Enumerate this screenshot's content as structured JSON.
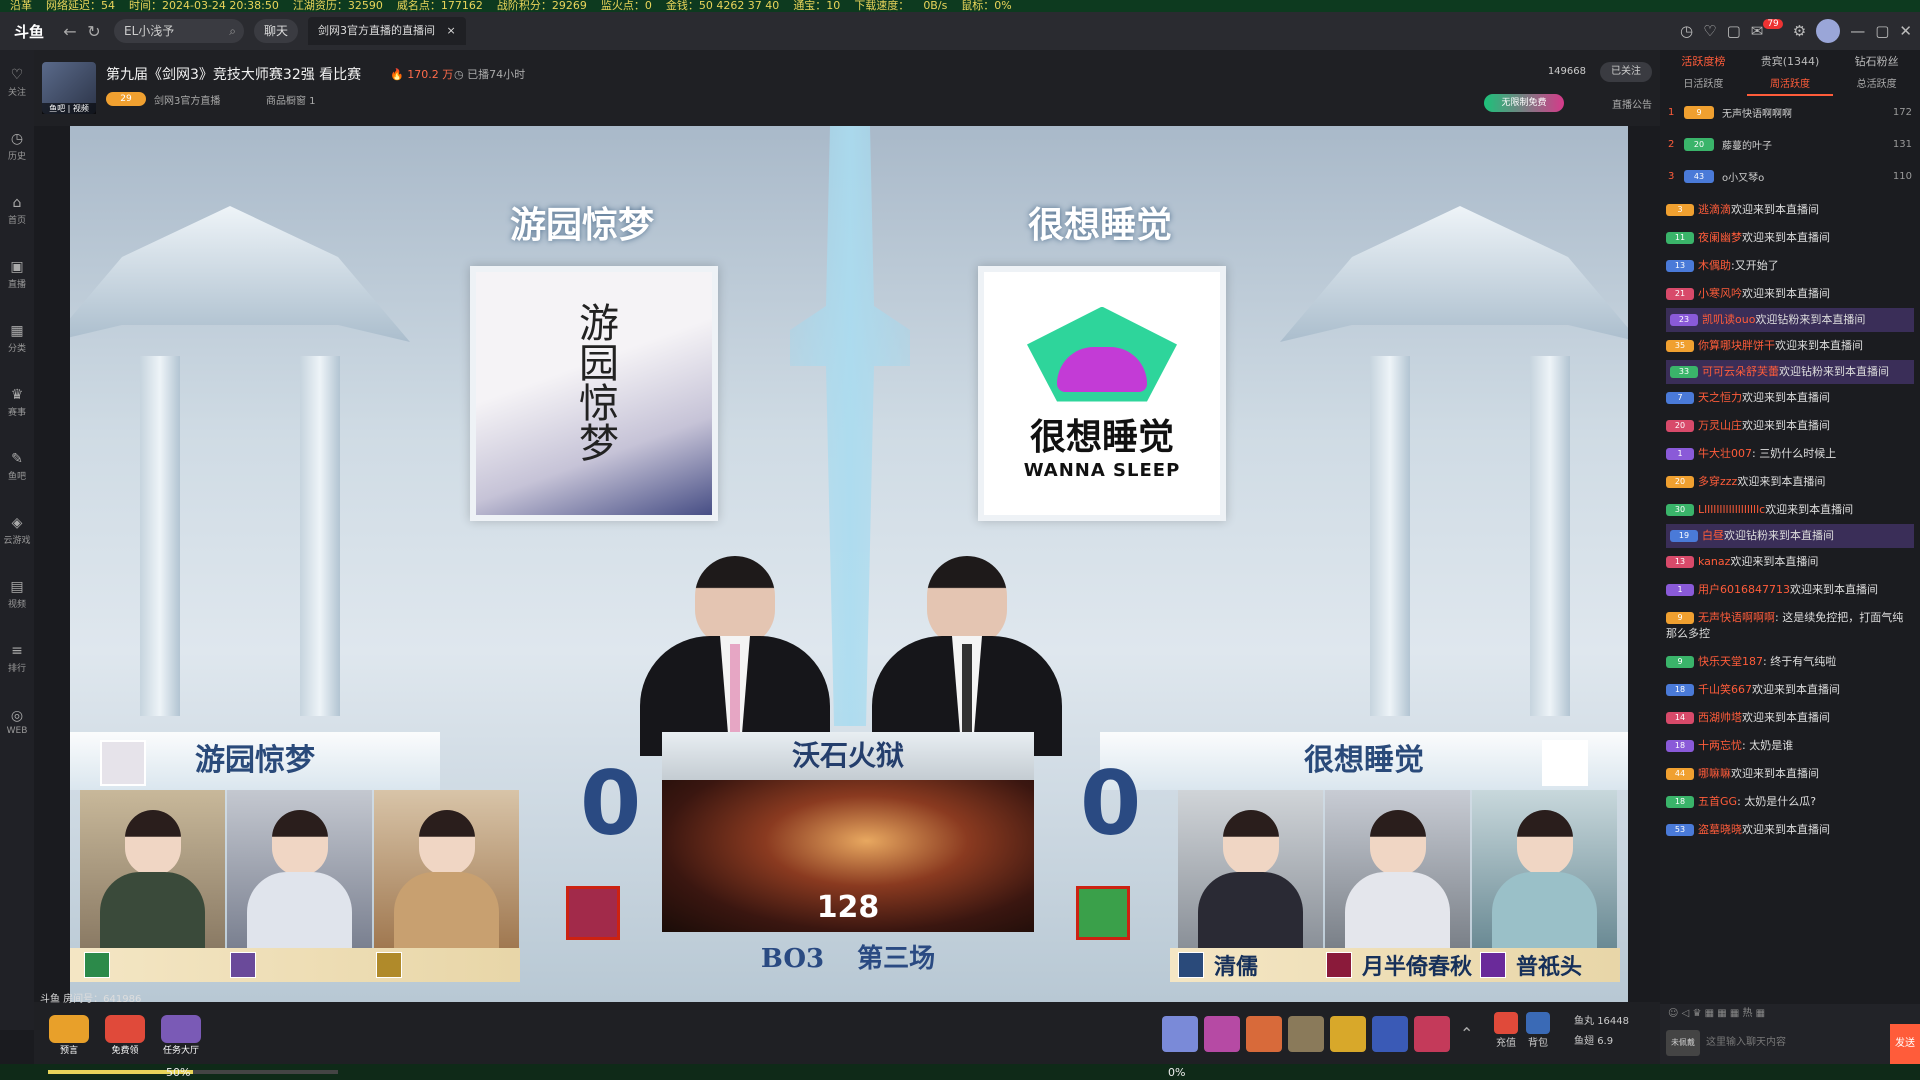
{
  "topstrip": {
    "items": [
      "沿革",
      "网络延迟：54",
      "时间：2024-03-24 20:38:50",
      "江湖资历：32590",
      "威名点：177162",
      "战阶积分：29269",
      "监火点：0",
      "金钱：50 4262 37 40",
      "通宝：10",
      "下载速度：",
      "0B/s",
      "鼠标：0%"
    ]
  },
  "titlebar": {
    "logo": "斗鱼",
    "back": "←",
    "refresh": "↻",
    "search_value": "EL小浅予",
    "search_icon": "⌕",
    "chat_label": "聊天",
    "tab_label": "剑网3官方直播的直播间",
    "tab_close": "×",
    "badge_count": "79"
  },
  "leftnav": [
    {
      "icon": "♡",
      "label": "关注"
    },
    {
      "icon": "◷",
      "label": "历史"
    },
    {
      "icon": "⌂",
      "label": "首页"
    },
    {
      "icon": "▣",
      "label": "直播"
    },
    {
      "icon": "▦",
      "label": "分类"
    },
    {
      "icon": "♛",
      "label": "赛事"
    },
    {
      "icon": "✎",
      "label": "鱼吧"
    },
    {
      "icon": "◈",
      "label": "云游戏"
    },
    {
      "icon": "▤",
      "label": "视频"
    },
    {
      "icon": "≡",
      "label": "排行"
    },
    {
      "icon": "◎",
      "label": "WEB"
    }
  ],
  "room": {
    "avatar_caption": "鱼吧 | 视频",
    "title": "第九届《剑网3》竞技大师赛32强 看比赛",
    "heat": "170.2 万",
    "live_time": "已播74小时",
    "level": "29",
    "anchor": "剑网3官方直播",
    "shop_window": "商品橱窗 1",
    "fans": "149668",
    "follow_label": "已关注",
    "promo": "无限制免费",
    "notice": "直播公告"
  },
  "stream": {
    "team_a_top": "游园惊梦",
    "team_b_top": "很想睡觉",
    "logo_a_text": "游园惊梦",
    "logo_b_cn": "很想睡觉",
    "logo_b_en": "WANNA SLEEP",
    "team_a": "游园惊梦",
    "team_b": "很想睡觉",
    "score_a": "0",
    "score_b": "0",
    "map_name": "沃石火狱",
    "timer": "128",
    "bo": "BO3",
    "round": "第三场",
    "players_b": [
      "清儒",
      "月半倚春秋",
      "普祇头"
    ]
  },
  "watermark": "斗鱼 房间号：641986",
  "bottombar": {
    "left_items": [
      "预言",
      "免费领",
      "任务大厅"
    ],
    "right_items": [
      "充值",
      "背包"
    ],
    "fish_balls_label": "鱼丸",
    "fish_balls": "16448",
    "fish_wings_label": "鱼翅",
    "fish_wings": "6.9"
  },
  "progress": {
    "left_pct": "50%",
    "right_pct": "0%",
    "left_value": 0.5
  },
  "chat": {
    "tabs": [
      "活跃度榜",
      "贵宾(1344)",
      "钻石粉丝"
    ],
    "subtabs": [
      "日活跃度",
      "周活跃度",
      "总活跃度"
    ],
    "ranks": [
      {
        "n": "1",
        "lv": "9",
        "name": "无声快语啊啊啊",
        "value": "172"
      },
      {
        "n": "2",
        "lv": "20",
        "name": "藤蔓的叶子",
        "value": "131"
      },
      {
        "n": "3",
        "lv": "43",
        "name": "o小又琴o",
        "value": "110"
      }
    ],
    "messages": [
      {
        "lv": "3",
        "user": "逃滴滴",
        "text": "欢迎来到本直播间",
        "hl": false
      },
      {
        "lv": "11",
        "user": "夜阑幽梦",
        "text": "欢迎来到本直播间",
        "hl": false
      },
      {
        "lv": "13",
        "user": "木偶助",
        "text": ":又开始了",
        "hl": false
      },
      {
        "lv": "21",
        "user": "小寒风吟",
        "text": "欢迎来到本直播间",
        "hl": false
      },
      {
        "lv": "23",
        "user": "凯叽读ouo",
        "text": "欢迎钻粉来到本直播间",
        "hl": true
      },
      {
        "lv": "35",
        "user": "你算哪块胖饼干",
        "text": "欢迎来到本直播间",
        "hl": false
      },
      {
        "lv": "33",
        "user": "可可云朵舒芙蕾",
        "text": "欢迎钻粉来到本直播间",
        "hl": true
      },
      {
        "lv": "7",
        "user": "天之恒力",
        "text": "欢迎来到本直播间",
        "hl": false
      },
      {
        "lv": "20",
        "user": "万灵山庄",
        "text": "欢迎来到本直播间",
        "hl": false
      },
      {
        "lv": "1",
        "user": "牛大壮007",
        "text": ": 三奶什么时候上",
        "hl": false
      },
      {
        "lv": "20",
        "user": "多穿zzz",
        "text": "欢迎来到本直播间",
        "hl": false
      },
      {
        "lv": "30",
        "user": "Lllllllllllllllllllc",
        "text": "欢迎来到本直播间",
        "hl": false
      },
      {
        "lv": "19",
        "user": "白昼",
        "text": "欢迎钻粉来到本直播间",
        "hl": true
      },
      {
        "lv": "13",
        "user": "kanaz",
        "text": "欢迎来到本直播间",
        "hl": false
      },
      {
        "lv": "1",
        "user": "用户6016847713",
        "text": "欢迎来到本直播间",
        "hl": false
      },
      {
        "lv": "9",
        "user": "无声快语啊啊啊",
        "text": ": 这是续免控把，打面气纯那么多控",
        "hl": false
      },
      {
        "lv": "9",
        "user": "快乐天堂187",
        "text": ": 终于有气纯啦",
        "hl": false
      },
      {
        "lv": "18",
        "user": "千山笑667",
        "text": "欢迎来到本直播间",
        "hl": false
      },
      {
        "lv": "14",
        "user": "西湖帅塔",
        "text": "欢迎来到本直播间",
        "hl": false
      },
      {
        "lv": "18",
        "user": "十两忘忧",
        "text": ": 太奶是谁",
        "hl": false
      },
      {
        "lv": "44",
        "user": "哪嘛嘛",
        "text": "欢迎来到本直播间",
        "hl": false
      },
      {
        "lv": "18",
        "user": "五首GG",
        "text": ": 太奶是什么瓜?",
        "hl": false
      },
      {
        "lv": "53",
        "user": "盗墓晓晓",
        "text": "欢迎来到本直播间",
        "hl": false
      }
    ],
    "input_placeholder": "这里输入聊天内容",
    "avatar_label": "未佩戴",
    "send_label": "发送"
  }
}
